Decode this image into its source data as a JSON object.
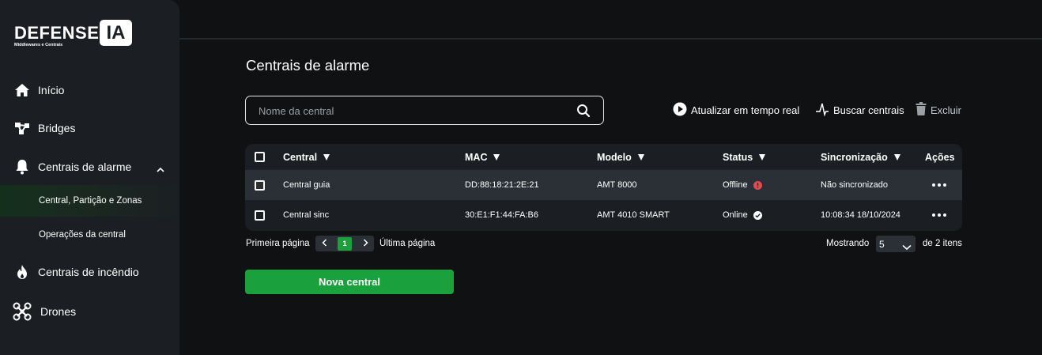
{
  "brand": {
    "name": "DEFENSE",
    "mark": "IA",
    "subtitle": "Middlewares e Centrais"
  },
  "sidebar": {
    "items": [
      {
        "label": "Início",
        "icon": "home-icon"
      },
      {
        "label": "Bridges",
        "icon": "bridges-icon"
      },
      {
        "label": "Centrais de alarme",
        "icon": "bell-icon",
        "expanded": true,
        "children": [
          {
            "label": "Central, Partição e Zonas",
            "active": true
          },
          {
            "label": "Operações da central",
            "active": false
          }
        ]
      },
      {
        "label": "Centrais de incêndio",
        "icon": "fire-icon"
      },
      {
        "label": "Drones",
        "icon": "drone-icon"
      }
    ]
  },
  "main": {
    "title": "Centrais de alarme",
    "search": {
      "placeholder": "Nome da central",
      "value": ""
    },
    "actions": {
      "realtime": "Atualizar em tempo real",
      "search_centrals": "Buscar centrais",
      "delete": "Excluir"
    },
    "table": {
      "columns": [
        "Central",
        "MAC",
        "Modelo",
        "Status",
        "Sincronização",
        "Ações"
      ],
      "rows": [
        {
          "central": "Central guia",
          "mac": "DD:88:18:21:2E:21",
          "model": "AMT 8000",
          "status": "Offline",
          "sync": "Não sincronizado"
        },
        {
          "central": "Central sinc",
          "mac": "30:E1:F1:44:FA:B6",
          "model": "AMT 4010 SMART",
          "status": "Online",
          "sync": "10:08:34 18/10/2024"
        }
      ]
    },
    "pagination": {
      "first": "Primeira página",
      "current_page": "1",
      "last": "Última página",
      "showing": "Mostrando",
      "page_size": "5",
      "total": "de 2 itens"
    },
    "new_button": "Nova central"
  },
  "colors": {
    "accent": "#1aa13d",
    "offline": "#e5484d",
    "sidebar_bg": "#1b1f23",
    "page_bg": "#0f1113"
  }
}
